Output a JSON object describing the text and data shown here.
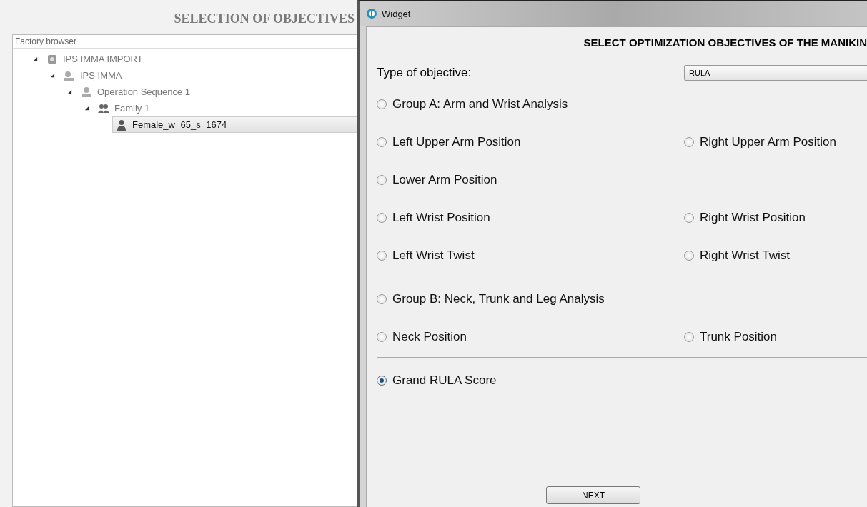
{
  "page_title": "SELECTION OF OBJECTIVES",
  "factory_browser": {
    "title": "Factory browser",
    "tree": [
      {
        "label": "IPS IMMA IMPORT",
        "kind": "import",
        "expanded": true,
        "selected": false,
        "children": [
          {
            "label": "IPS IMMA",
            "kind": "system",
            "expanded": true,
            "selected": false,
            "children": [
              {
                "label": "Operation Sequence 1",
                "kind": "sequence",
                "expanded": true,
                "selected": false,
                "children": [
                  {
                    "label": "Family 1",
                    "kind": "family",
                    "expanded": true,
                    "selected": false,
                    "children": [
                      {
                        "label": "Female_w=65_s=1674",
                        "kind": "manikin",
                        "selected": true
                      }
                    ]
                  }
                ]
              }
            ]
          }
        ]
      }
    ]
  },
  "widget": {
    "title": "Widget",
    "heading": "SELECT OPTIMIZATION OBJECTIVES OF THE MANIKIN",
    "objective_type": {
      "label": "Type of objective:",
      "value": "RULA"
    },
    "sections": [
      {
        "rows": [
          {
            "items": [
              {
                "label": "Group A: Arm and Wrist Analysis",
                "selected": false
              }
            ]
          },
          {
            "items": [
              {
                "label": "Left Upper Arm Position",
                "selected": false
              },
              {
                "label": "Right Upper Arm Position",
                "selected": false
              }
            ]
          },
          {
            "items": [
              {
                "label": "Lower Arm Position",
                "selected": false
              }
            ]
          },
          {
            "items": [
              {
                "label": "Left Wrist Position",
                "selected": false
              },
              {
                "label": "Right Wrist Position",
                "selected": false
              }
            ]
          },
          {
            "items": [
              {
                "label": "Left Wrist Twist",
                "selected": false
              },
              {
                "label": "Right Wrist Twist",
                "selected": false
              }
            ]
          }
        ]
      },
      {
        "rows": [
          {
            "items": [
              {
                "label": "Group B: Neck, Trunk and Leg Analysis",
                "selected": false
              }
            ]
          },
          {
            "items": [
              {
                "label": "Neck Position",
                "selected": false
              },
              {
                "label": "Trunk Position",
                "selected": false
              }
            ]
          }
        ]
      },
      {
        "rows": [
          {
            "items": [
              {
                "label": "Grand RULA Score",
                "selected": true
              }
            ]
          }
        ]
      }
    ],
    "button": "NEXT"
  }
}
